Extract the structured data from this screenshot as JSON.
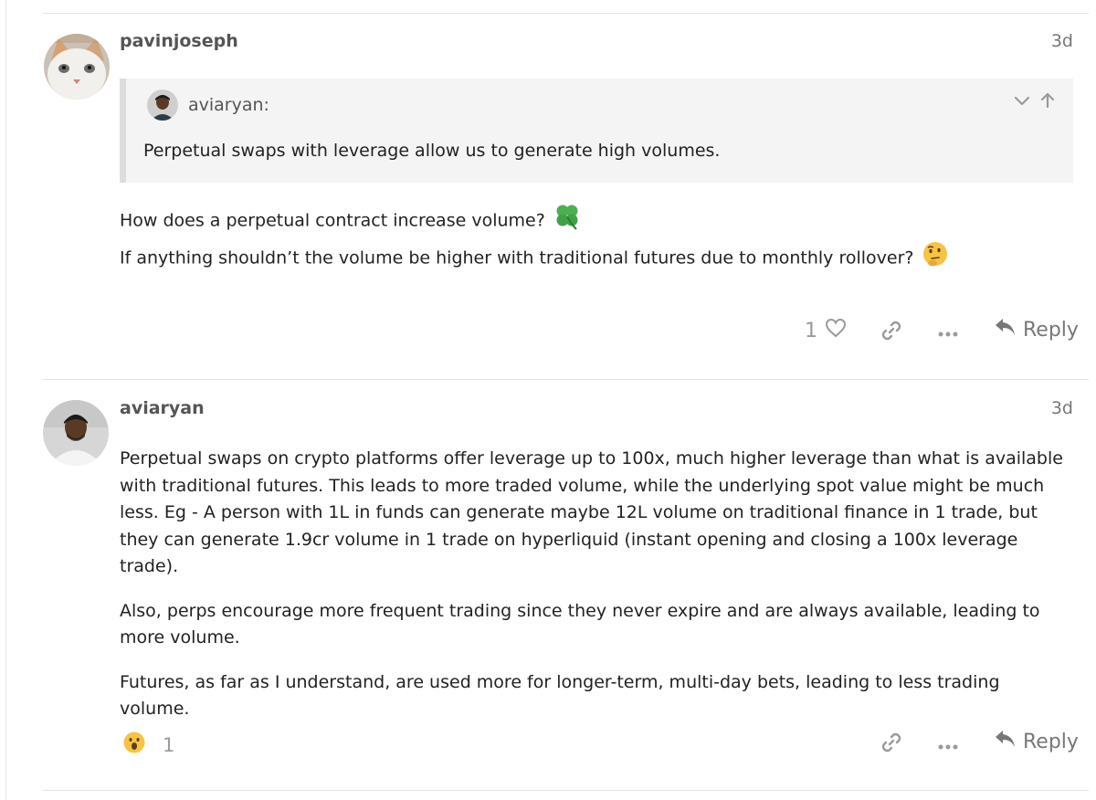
{
  "posts": [
    {
      "username": "pavinjoseph",
      "date": "3d",
      "avatar_icon": "cat-avatar",
      "quote": {
        "author": "aviaryan:",
        "text": "Perpetual swaps with leverage allow us to generate high volumes."
      },
      "body": [
        "How does a perpetual contract increase volume?",
        "If anything shouldn’t the volume be higher with traditional futures due to monthly rollover?"
      ],
      "like_count": "1",
      "reply_label": "Reply"
    },
    {
      "username": "aviaryan",
      "date": "3d",
      "avatar_icon": "person-avatar",
      "body": [
        "Perpetual swaps on crypto platforms offer leverage up to 100x, much higher leverage than what is available with traditional futures. This leads to more traded volume, while the underlying spot value might be much less. Eg - A person with 1L in funds can generate maybe 12L volume on traditional finance in 1 trade, but they can generate 1.9cr volume in 1 trade on hyperliquid (instant opening and closing a 100x leverage trade).",
        "Also, perps encourage more frequent trading since they never expire and are always available, leading to more volume.",
        "Futures, as far as I understand, are used more for longer-term, multi-day bets, leading to less trading volume."
      ],
      "reaction_count": "1",
      "reply_label": "Reply"
    }
  ],
  "icons": {
    "clover": "four-leaf-clover-emoji",
    "thinking": "thinking-face-emoji",
    "surprised": "surprised-face-emoji",
    "heart": "heart-icon",
    "link": "link-icon",
    "more": "ellipsis-icon",
    "reply": "reply-arrow-icon",
    "expand": "chevron-down-icon",
    "jump": "arrow-up-icon"
  },
  "colors": {
    "muted_text": "#777777",
    "quote_bg": "#f4f4f4",
    "quote_border": "#dddddd",
    "clover": "#4caf50",
    "emoji_face": "#f6c443"
  }
}
